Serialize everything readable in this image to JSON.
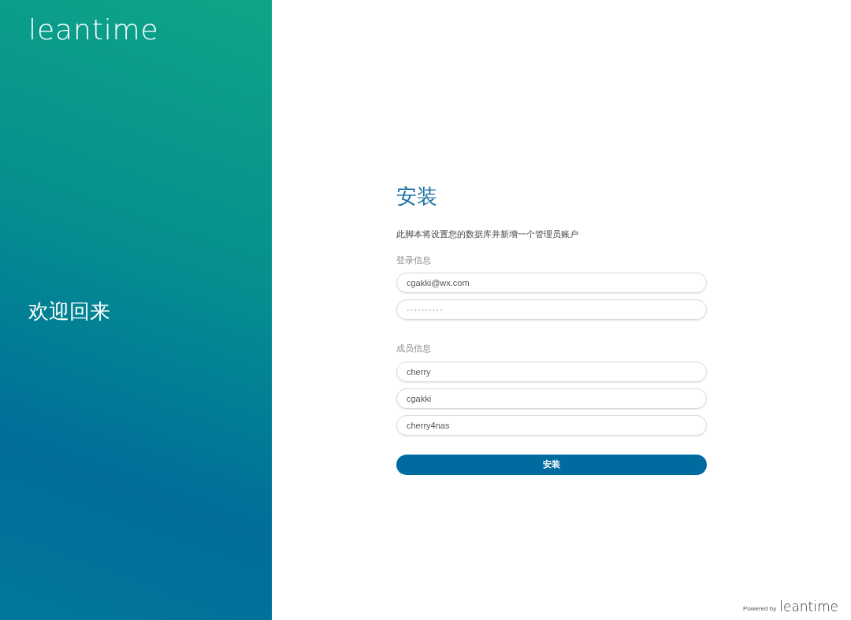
{
  "brand": {
    "logo": "leantime",
    "welcome": "欢迎回来"
  },
  "form": {
    "title": "安装",
    "description": "此脚本将设置您的数据库并新增一个管理员账户",
    "sections": [
      {
        "label": "登录信息",
        "fields": [
          {
            "kind": "text",
            "value": "cgakki@wx.com"
          },
          {
            "kind": "password",
            "value": "··········"
          }
        ]
      },
      {
        "label": "成员信息",
        "fields": [
          {
            "kind": "text",
            "value": "cherry"
          },
          {
            "kind": "text",
            "value": "cgakki"
          },
          {
            "kind": "text",
            "value": "cherry4nas"
          }
        ]
      }
    ],
    "submit": "安装"
  },
  "footer": {
    "powered_by": "Powered by",
    "logo": "leantime"
  }
}
